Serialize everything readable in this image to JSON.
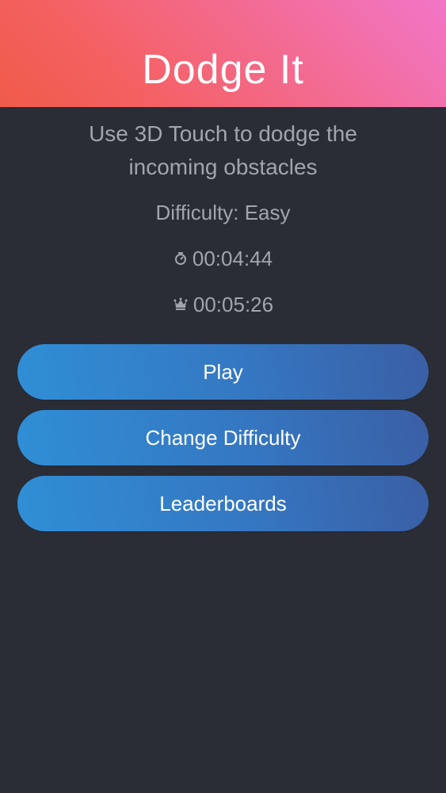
{
  "header": {
    "title": "Dodge It",
    "gradient_start": "#f05b4a",
    "gradient_end": "#f276c8"
  },
  "subtitle": "Use 3D Touch to dodge the incoming obstacles",
  "difficulty": "Difficulty: Easy",
  "stats": {
    "current_time_icon": "stopwatch-icon",
    "current_time": "00:04:44",
    "best_time_icon": "crown-icon",
    "best_time": "00:05:26"
  },
  "buttons": {
    "play": "Play",
    "change_difficulty": "Change Difficulty",
    "leaderboards": "Leaderboards",
    "color": "#3577c2"
  },
  "background_color": "#2a2c36"
}
